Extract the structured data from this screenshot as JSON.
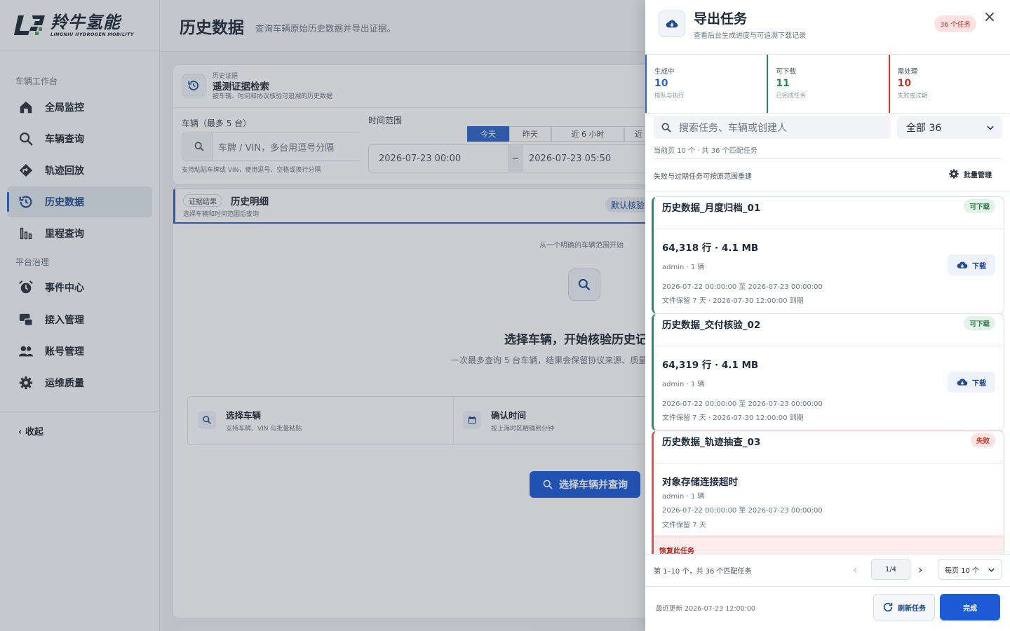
{
  "brand": {
    "cn": "羚牛氢能",
    "en": "LINGNIU HYDROGEN MOBILITY"
  },
  "sidebar": {
    "section1": "车辆工作台",
    "section2": "平台治理",
    "items": [
      {
        "label": "全局监控",
        "icon": "home-icon"
      },
      {
        "label": "车辆查询",
        "icon": "search-icon"
      },
      {
        "label": "轨迹回放",
        "icon": "route-icon"
      },
      {
        "label": "历史数据",
        "icon": "history-icon",
        "active": true
      },
      {
        "label": "里程查询",
        "icon": "bar-chart-icon"
      },
      {
        "label": "事件中心",
        "icon": "alarm-icon"
      },
      {
        "label": "接入管理",
        "icon": "connect-icon"
      },
      {
        "label": "账号管理",
        "icon": "users-icon"
      },
      {
        "label": "运维质量",
        "icon": "gear-icon"
      }
    ],
    "collapse": "收起"
  },
  "header": {
    "title": "历史数据",
    "subtitle": "查询车辆原始历史数据并导出证据。"
  },
  "query": {
    "kicker": "历史证据",
    "title": "遥测证据检索",
    "desc": "按车辆、时间和协议核验可追溯的历史数据",
    "vehicle_label": "车辆（最多 5 台）",
    "vehicle_placeholder": "车牌 / VIN，多台用逗号分隔",
    "vehicle_hint": "支持粘贴车牌或 VIN，使用逗号、空格或换行分隔",
    "time_label": "时间范围",
    "chips": [
      "今天",
      "昨天",
      "近 6 小时",
      "近"
    ],
    "start": "2026-07-23 00:00",
    "sep": "~",
    "end": "2026-07-23 05:50"
  },
  "result": {
    "tag": "证据结果",
    "title": "历史明细",
    "desc": "选择车辆和时间范围后查询",
    "badge": "默认核验",
    "hint": "从一个明确的车辆范围开始",
    "empty_title": "选择车辆，开始核验历史记",
    "empty_desc": "一次最多查询 5 台车辆，结果会保留协议来源、质量",
    "step1_title": "选择车辆",
    "step1_desc": "支持车牌、VIN 与批量粘贴",
    "step2_title": "确认时间",
    "step2_desc": "按上海时区精确到分钟",
    "cta": "选择车辆并查询"
  },
  "drawer": {
    "title": "导出任务",
    "subtitle": "查看后台生成进度与可追溯下载记录",
    "badge": "36 个任务",
    "close": "×",
    "stats": [
      {
        "key": "生成中",
        "value": "10",
        "hint": "排队与执行",
        "color": "#2f64c8"
      },
      {
        "key": "可下载",
        "value": "11",
        "hint": "已完成任务",
        "color": "#2e8b57"
      },
      {
        "key": "需处理",
        "value": "10",
        "hint": "失败或过期",
        "color": "#c0392b"
      }
    ],
    "search_placeholder": "搜索任务、车辆或创建人",
    "filter": "全部 36",
    "meta": "当前页 10 个 · 共 36 个匹配任务",
    "note": "失败与过期任务可按原范围重建",
    "bulk": "批量管理",
    "tasks": [
      {
        "title": "历史数据_月度归档_01",
        "status": "可下载",
        "size": "64,318 行 · 4.1 MB",
        "by": "admin · 1 辆",
        "range": "2026-07-22 00:00:00 至 2026-07-23 00:00:00",
        "retain": "文件保留 7 天 · 2026-07-30 12:00:00 到期",
        "action": "下载"
      },
      {
        "title": "历史数据_交付核验_02",
        "status": "可下载",
        "size": "64,319 行 · 4.1 MB",
        "by": "admin · 1 辆",
        "range": "2026-07-22 00:00:00 至 2026-07-23 00:00:00",
        "retain": "文件保留 7 天 · 2026-07-30 12:00:00 到期",
        "action": "下载"
      },
      {
        "title": "历史数据_轨迹抽查_03",
        "status": "失败",
        "size": "对象存储连接超时",
        "by": "admin · 1 辆",
        "range": "2026-07-22 00:00:00 至 2026-07-23 00:00:00",
        "retain": "文件保留 7 天",
        "restore": "恢复此任务"
      }
    ],
    "pager": {
      "info": "第 1–10 个，共 36 个匹配任务",
      "page": "1/4",
      "size": "每页 10 个"
    },
    "updated": "最近更新 2026-07-23 12:00:00",
    "refresh": "刷新任务",
    "done": "完成"
  },
  "colors": {
    "accent": "#1c5ad6",
    "ok": "#2e8b57",
    "fail": "#c0392b"
  }
}
